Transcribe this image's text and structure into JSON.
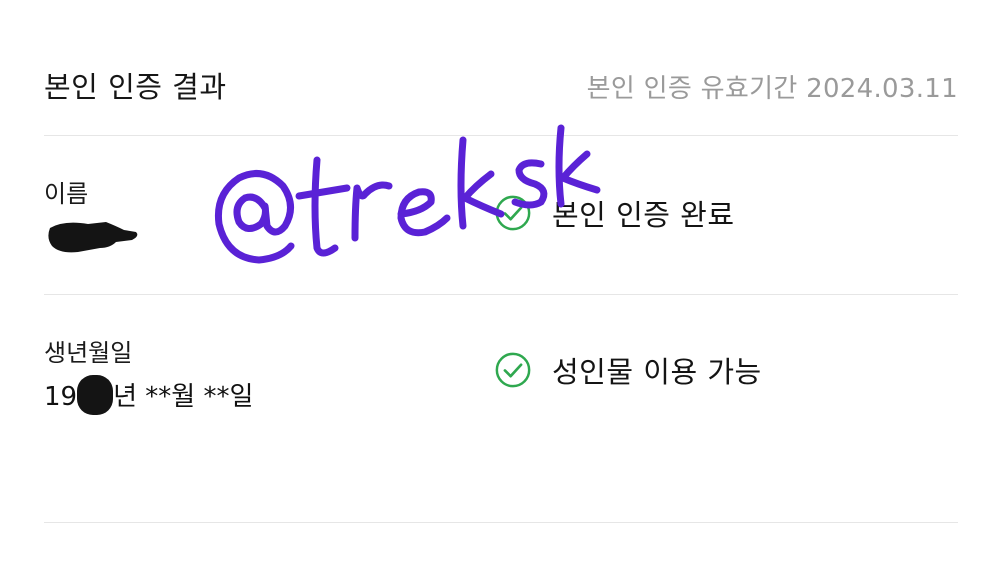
{
  "header": {
    "title": "본인 인증 결과",
    "validity": "본인 인증 유효기간 2024.03.11"
  },
  "name_section": {
    "label": "이름",
    "status": "본인 인증 완료"
  },
  "birth_section": {
    "label": "생년월일",
    "value_prefix": "19",
    "value_suffix": "년 **월 **일",
    "status": "성인물 이용 가능"
  },
  "watermark": {
    "text": "@trksk"
  },
  "colors": {
    "check_green": "#2fa84f",
    "watermark_purple": "#5a22d6",
    "muted_text": "#9a9a9a",
    "divider": "#e6e6e6"
  },
  "icons": {
    "status_check": "check-circle-icon"
  }
}
